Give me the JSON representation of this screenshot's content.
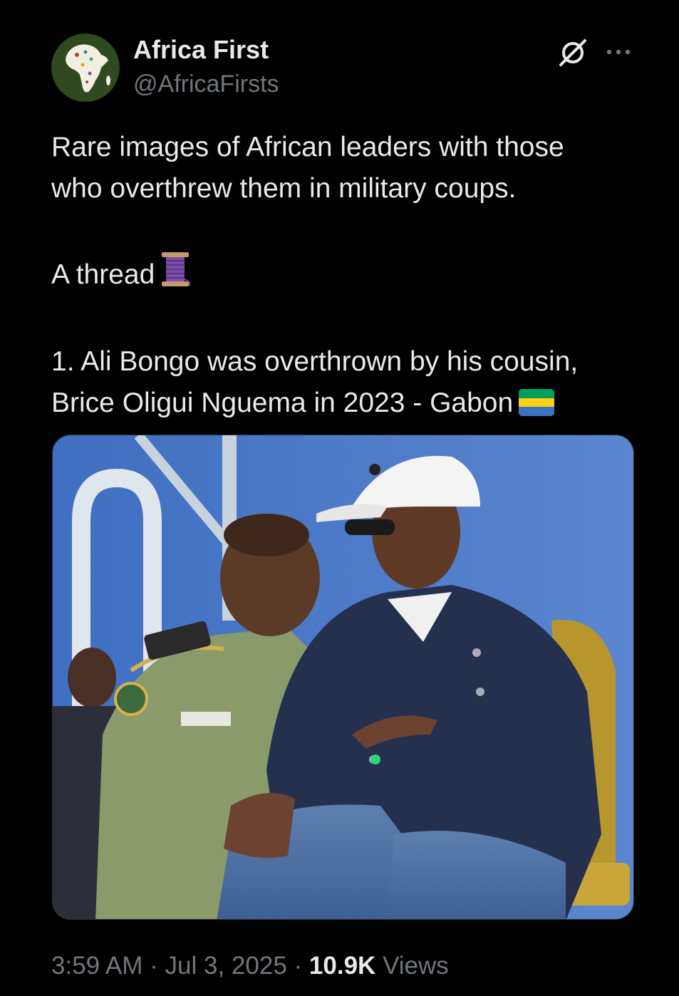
{
  "author": {
    "display_name": "Africa First",
    "handle": "@AfricaFirsts",
    "avatar_icon": "africa-map-avatar"
  },
  "header_icons": {
    "grok": "grok-icon",
    "more": "more-options-icon"
  },
  "tweet": {
    "line1": "Rare images of African leaders with those",
    "line2": "who overthrew them in military coups.",
    "line3": "A thread",
    "thread_emoji": "spool-of-thread-emoji",
    "line4": "1. Ali Bongo was overthrown by his cousin,",
    "line5": "Brice Oligui Nguema in 2023 - Gabon",
    "flag_emoji": "gabon-flag-emoji"
  },
  "media": {
    "type": "photo"
  },
  "meta": {
    "time": "3:59 AM",
    "separator": "·",
    "date": "Jul 3, 2025",
    "views_count": "10.9K",
    "views_label": "Views"
  },
  "colors": {
    "background": "#000000",
    "text_primary": "#e7e9ea",
    "text_secondary": "#71767b",
    "gabon_green": "#009e60",
    "gabon_yellow": "#fcd116",
    "gabon_blue": "#3a75c4"
  }
}
